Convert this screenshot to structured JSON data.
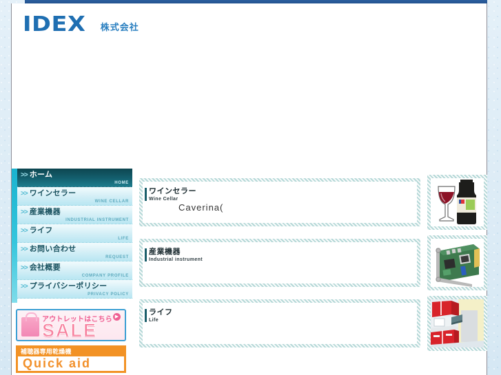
{
  "site": {
    "logo_text": "IDEX",
    "logo_suffix": "株式会社",
    "brand_color": "#1f6fb2"
  },
  "sidebar": {
    "nav_arrow": ">>",
    "items": [
      {
        "jp": "ホーム",
        "en": "HOME",
        "active": true
      },
      {
        "jp": "ワインセラー",
        "en": "WINE CELLAR",
        "active": false
      },
      {
        "jp": "産業機器",
        "en": "INDUSTRIAL INSTRUMENT",
        "active": false
      },
      {
        "jp": "ライフ",
        "en": "LIFE",
        "active": false
      },
      {
        "jp": "お問い合わせ",
        "en": "REQUEST",
        "active": false
      },
      {
        "jp": "会社概要",
        "en": "COMPANY PROFILE",
        "active": false
      },
      {
        "jp": "プライバシーポリシー",
        "en": "PRIVACY POLICY",
        "active": false
      }
    ],
    "banners": {
      "sale": {
        "top_text": "アウトレットはこちら",
        "big_text": "SALE",
        "play_icon": "▶",
        "border_color": "#3b9fd4",
        "accent_color": "#ef5f92"
      },
      "quick_aid": {
        "top_text": "補聴器専用乾燥機",
        "main_text": "Quick aid",
        "accent_color": "#f29225"
      }
    }
  },
  "main": {
    "sections": [
      {
        "jp": "ワインセラー",
        "en": "Wine Cellar",
        "body": "Caverina(",
        "thumb": "wine-bottle-and-glass"
      },
      {
        "jp": "産業機器",
        "en": "Industrial instrument",
        "body": "",
        "thumb": "circuit-board"
      },
      {
        "jp": "ライフ",
        "en": "Life",
        "body": "",
        "thumb": "kitchen-interior"
      }
    ]
  }
}
